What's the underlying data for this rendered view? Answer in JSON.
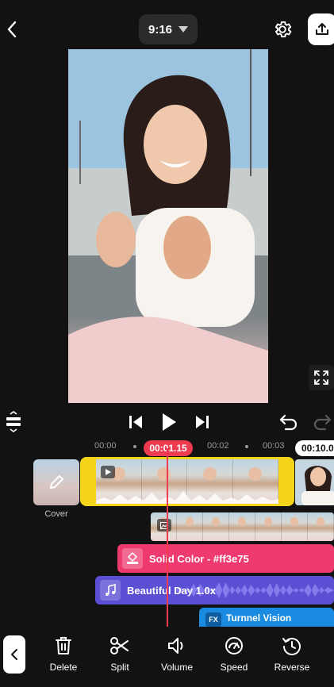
{
  "header": {
    "aspect_ratio": "9:16"
  },
  "timeline": {
    "ruler": [
      "00:00",
      "00:02",
      "00:03"
    ],
    "current_time": "00:01.15",
    "end_time": "00:10.0",
    "cover_label": "Cover"
  },
  "tracks": {
    "solid_color": "Solid Color - #ff3e75",
    "audio": "Beautiful Day 1.0x",
    "effect": "Turnnel Vision"
  },
  "toolbar": {
    "items": [
      {
        "label": "Delete",
        "icon": "trash-icon"
      },
      {
        "label": "Split",
        "icon": "scissors-icon"
      },
      {
        "label": "Volume",
        "icon": "speaker-icon"
      },
      {
        "label": "Speed",
        "icon": "speedometer-icon"
      },
      {
        "label": "Reverse",
        "icon": "reverse-clock-icon"
      }
    ]
  },
  "colors": {
    "clip_border": "#f4d51c",
    "playhead": "#ef3b4f",
    "solid_track": "#ef3a6f",
    "audio_track": "#5b4fd4",
    "effect_track": "#1a8be0"
  }
}
